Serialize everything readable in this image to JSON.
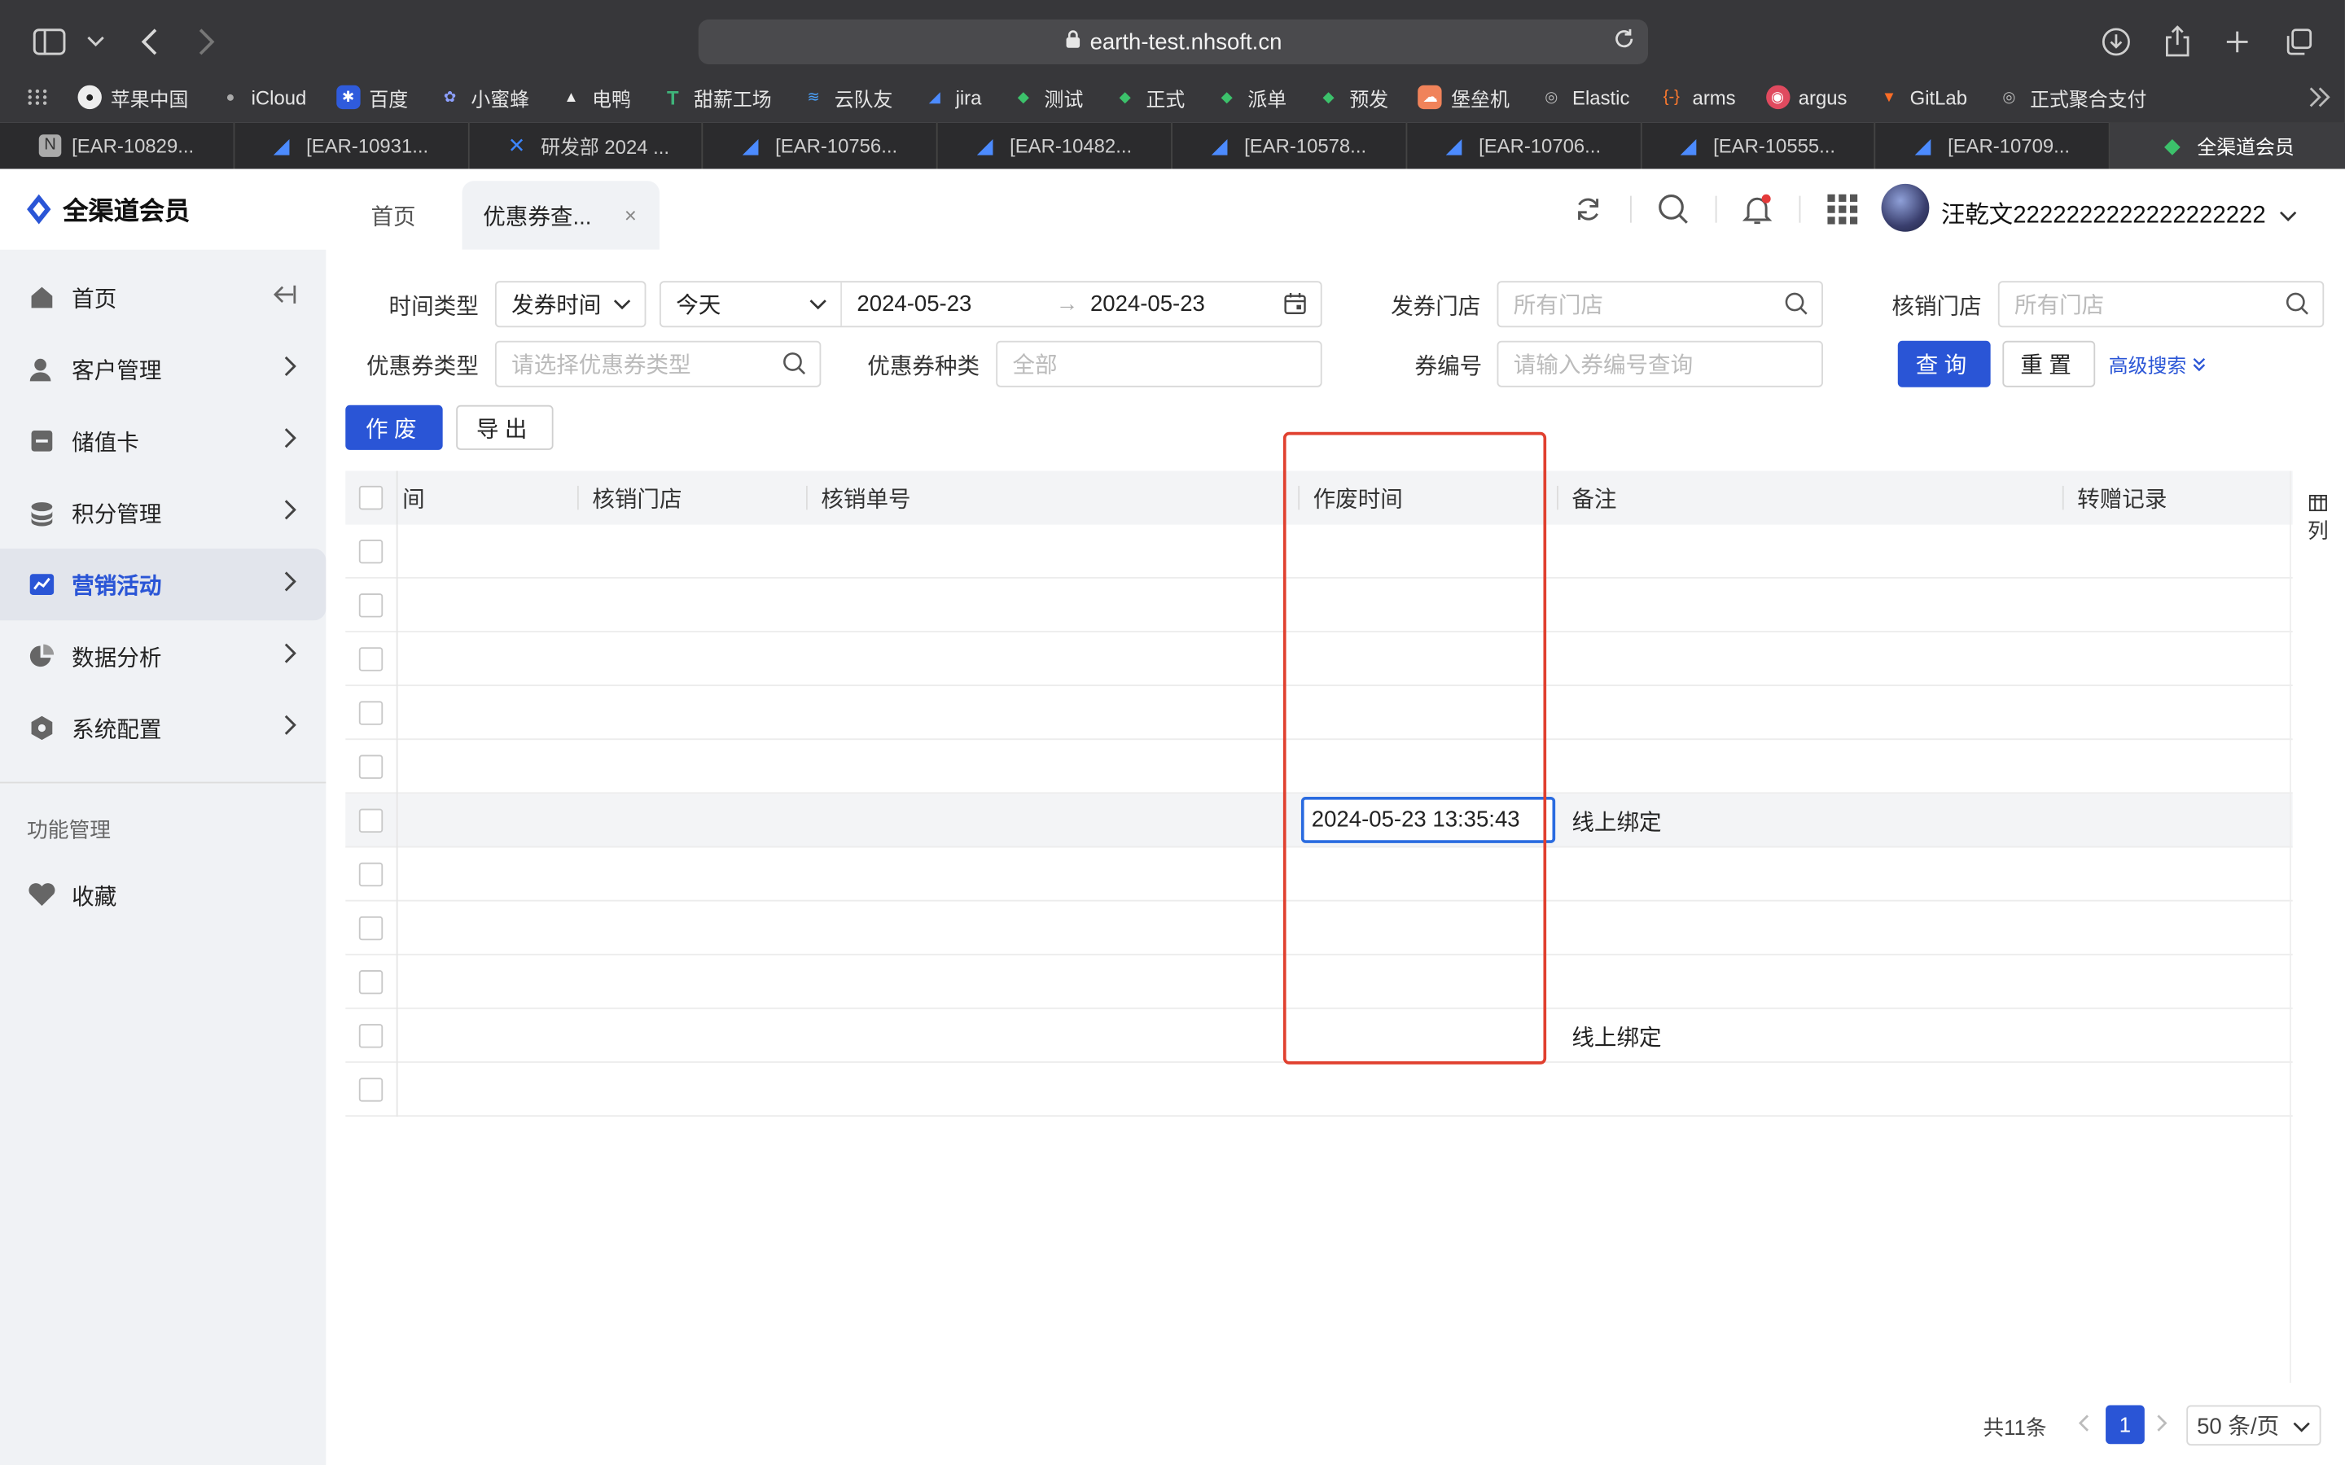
{
  "browser": {
    "url": "earth-test.nhsoft.cn",
    "bookmarks": [
      {
        "label": "苹果中国",
        "icon": "apple-icon"
      },
      {
        "label": "iCloud",
        "icon": "apple-icon"
      },
      {
        "label": "百度",
        "icon": "baidu-icon"
      },
      {
        "label": "小蜜蜂",
        "icon": "bee-icon"
      },
      {
        "label": "电鸭",
        "icon": "duck-icon"
      },
      {
        "label": "甜薪工场",
        "icon": "t-icon"
      },
      {
        "label": "云队友",
        "icon": "wave-icon"
      },
      {
        "label": "jira",
        "icon": "jira-icon"
      },
      {
        "label": "测试",
        "icon": "leaf-icon"
      },
      {
        "label": "正式",
        "icon": "leaf-icon"
      },
      {
        "label": "派单",
        "icon": "leaf-icon"
      },
      {
        "label": "预发",
        "icon": "leaf-icon"
      },
      {
        "label": "堡垒机",
        "icon": "cloud-icon"
      },
      {
        "label": "Elastic",
        "icon": "globe-icon"
      },
      {
        "label": "arms",
        "icon": "bracket-icon"
      },
      {
        "label": "argus",
        "icon": "argus-icon"
      },
      {
        "label": "GitLab",
        "icon": "gitlab-icon"
      },
      {
        "label": "正式聚合支付",
        "icon": "globe-icon"
      }
    ],
    "tabs": [
      {
        "label": "[EAR-10829...",
        "icon": "notion-icon"
      },
      {
        "label": "[EAR-10931...",
        "icon": "jira-icon"
      },
      {
        "label": "研发部 2024 ...",
        "icon": "confluence-icon"
      },
      {
        "label": "[EAR-10756...",
        "icon": "jira-icon"
      },
      {
        "label": "[EAR-10482...",
        "icon": "jira-icon"
      },
      {
        "label": "[EAR-10578...",
        "icon": "jira-icon"
      },
      {
        "label": "[EAR-10706...",
        "icon": "jira-icon"
      },
      {
        "label": "[EAR-10555...",
        "icon": "jira-icon"
      },
      {
        "label": "[EAR-10709...",
        "icon": "jira-icon"
      },
      {
        "label": "全渠道会员",
        "icon": "leaf-icon"
      }
    ]
  },
  "app": {
    "logo": "全渠道会员",
    "tabs": [
      {
        "label": "首页"
      },
      {
        "label": "优惠券查..."
      }
    ],
    "close_mark": "×",
    "username": "汪乾文2222222222222222222"
  },
  "sidebar": {
    "items": [
      {
        "label": "首页",
        "icon": "home-icon"
      },
      {
        "label": "客户管理",
        "icon": "user-icon"
      },
      {
        "label": "储值卡",
        "icon": "card-icon"
      },
      {
        "label": "积分管理",
        "icon": "coins-icon"
      },
      {
        "label": "营销活动",
        "icon": "chart-icon"
      },
      {
        "label": "数据分析",
        "icon": "pie-icon"
      },
      {
        "label": "系统配置",
        "icon": "hex-icon"
      }
    ],
    "section_title": "功能管理",
    "favorites": {
      "label": "收藏",
      "icon": "heart-icon"
    }
  },
  "filters": {
    "time_type_label": "时间类型",
    "time_type_value": "发券时间",
    "range_preset": "今天",
    "date_start": "2024-05-23",
    "date_end": "2024-05-23",
    "range_arrow": "→",
    "issue_store_label": "发券门店",
    "issue_store_placeholder": "所有门店",
    "redeem_store_label": "核销门店",
    "redeem_store_placeholder": "所有门店",
    "coupon_type_label": "优惠券类型",
    "coupon_type_placeholder": "请选择优惠券类型",
    "coupon_kind_label": "优惠券种类",
    "coupon_kind_placeholder": "全部",
    "coupon_no_label": "券编号",
    "coupon_no_placeholder": "请输入券编号查询",
    "query_label": "查询",
    "reset_label": "重置",
    "advanced_label": "高级搜索"
  },
  "actions": {
    "void_label": "作废",
    "export_label": "导出"
  },
  "table": {
    "columns": [
      "间",
      "核销门店",
      "核销单号",
      "作废时间",
      "备注",
      "转赠记录"
    ],
    "column_toggle_label": "列",
    "rows": [
      {
        "void_time": "",
        "remark": ""
      },
      {
        "void_time": "",
        "remark": ""
      },
      {
        "void_time": "",
        "remark": ""
      },
      {
        "void_time": "",
        "remark": ""
      },
      {
        "void_time": "",
        "remark": ""
      },
      {
        "void_time": "2024-05-23 13:35:43",
        "remark": "线上绑定"
      },
      {
        "void_time": "",
        "remark": ""
      },
      {
        "void_time": "",
        "remark": ""
      },
      {
        "void_time": "",
        "remark": ""
      },
      {
        "void_time": "",
        "remark": "线上绑定"
      },
      {
        "void_time": "",
        "remark": ""
      }
    ]
  },
  "pagination": {
    "total": "共11条",
    "current_page": "1",
    "page_size": "50 条/页"
  },
  "colors": {
    "primary": "#2a55d6",
    "highlight_box": "#e0402f"
  }
}
